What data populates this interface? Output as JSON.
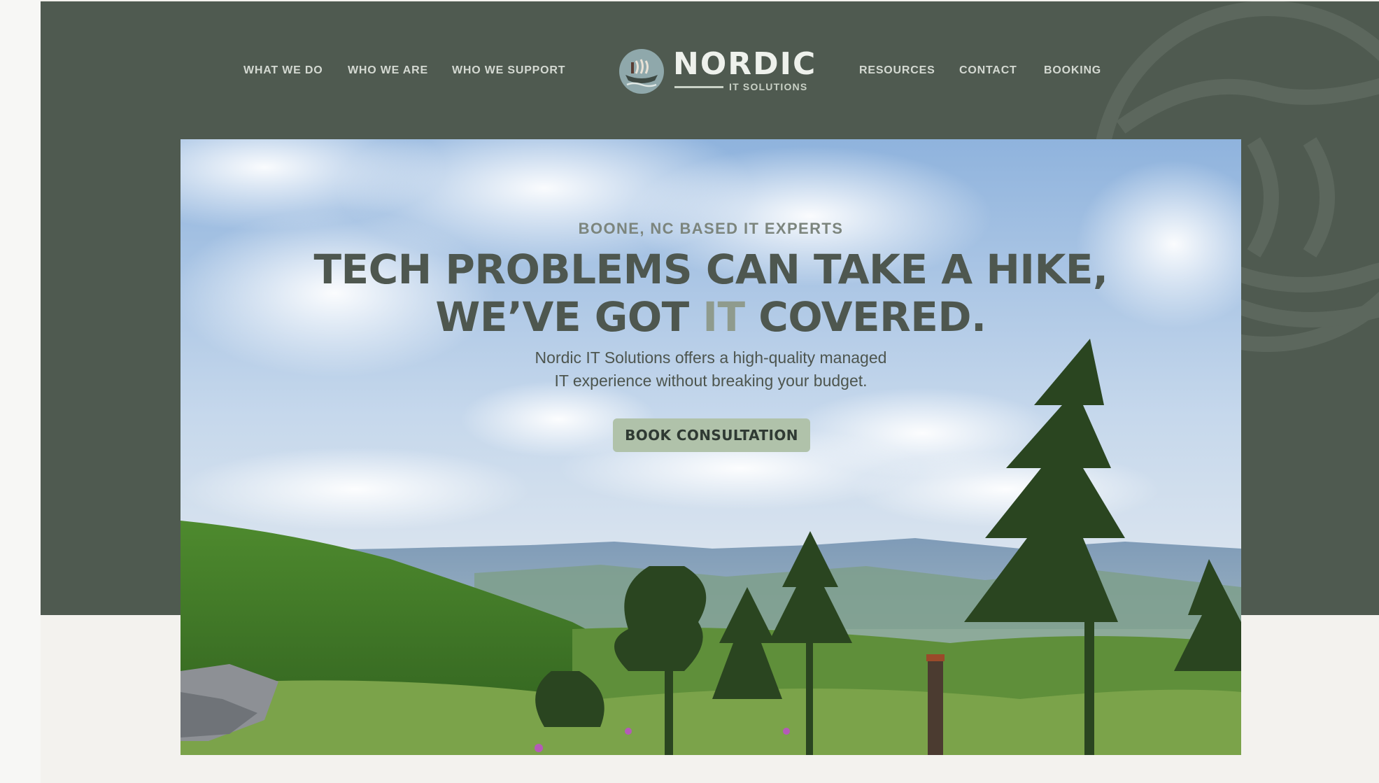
{
  "brand": {
    "name": "NORDIC",
    "tagline": "IT SOLUTIONS"
  },
  "nav": {
    "left": [
      "WHAT WE DO",
      "WHO WE ARE",
      "WHO WE SUPPORT"
    ],
    "right": [
      "RESOURCES",
      "CONTACT",
      "BOOKING"
    ]
  },
  "hero": {
    "eyebrow": "BOONE, NC BASED IT EXPERTS",
    "headline_line1": "TECH PROBLEMS CAN TAKE A HIKE,",
    "headline_line2_pre": "WE’VE GOT ",
    "headline_line2_accent": "IT",
    "headline_line2_post": " COVERED.",
    "subtext_line1": "Nordic IT Solutions offers a high-quality managed",
    "subtext_line2": "IT experience without breaking your budget.",
    "cta_label": "BOOK CONSULTATION"
  },
  "colors": {
    "header_bg": "#4f5a50",
    "page_bg": "#f3f2ee",
    "cta_bg": "#b0c2aa",
    "headline": "#4e574f",
    "accent": "#8f9b8d"
  },
  "icons": {
    "logo": "viking-ship-emblem-icon",
    "background": "viking-ship-watermark-icon"
  }
}
